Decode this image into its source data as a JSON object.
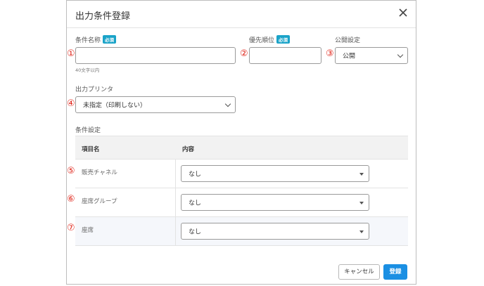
{
  "modal": {
    "title": "出力条件登録"
  },
  "fields": {
    "condition_name": {
      "label": "条件名称",
      "badge": "必須",
      "number": "①",
      "value": "",
      "hint": "40文字以内"
    },
    "priority": {
      "label": "優先順位",
      "badge": "必須",
      "number": "②",
      "value": ""
    },
    "public": {
      "label": "公開設定",
      "number": "③",
      "value": "公開"
    },
    "printer": {
      "label": "出力プリンタ",
      "number": "④",
      "value": "未指定（印刷しない）"
    }
  },
  "conditions": {
    "section_label": "条件設定",
    "headers": {
      "item": "項目名",
      "content": "内容"
    },
    "rows": [
      {
        "number": "⑤",
        "name": "販売チャネル",
        "value": "なし"
      },
      {
        "number": "⑥",
        "name": "座席グループ",
        "value": "なし"
      },
      {
        "number": "⑦",
        "name": "座席",
        "value": "なし"
      }
    ]
  },
  "buttons": {
    "cancel": "キャンセル",
    "submit": "登録"
  },
  "colors": {
    "accent": "#1a8fe3",
    "badge": "#1aa3c8",
    "number": "#e0261b",
    "row_highlight": "#f5f7fb"
  }
}
